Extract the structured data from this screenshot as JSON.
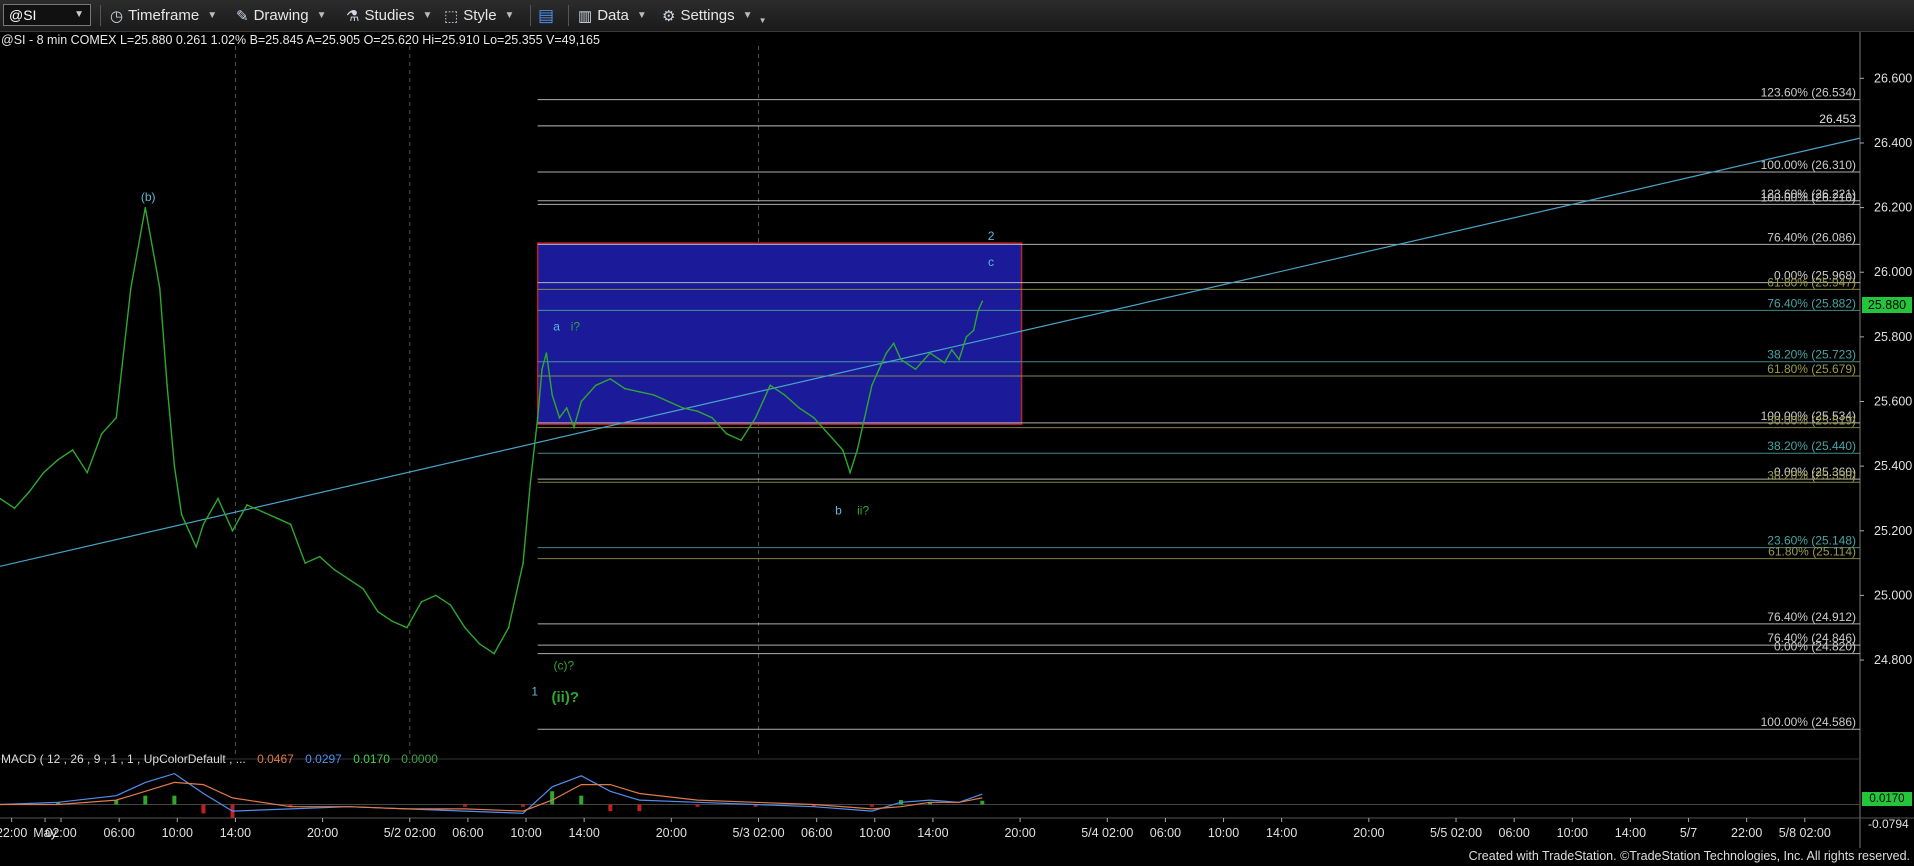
{
  "toolbar": {
    "symbol": "@SI",
    "timeframe": "Timeframe",
    "drawing": "Drawing",
    "studies": "Studies",
    "style": "Style",
    "data": "Data",
    "settings": "Settings"
  },
  "info": {
    "line": "@SI - 8 min  COMEX  L=25.880  0.261  1.02%  B=25.845  A=25.905  O=25.620  Hi=25.910  Lo=25.355  V=49,165"
  },
  "macd": {
    "label": "MACD ( 12 , 26 , 9 , 1 , 1 , UpColorDefault , ...",
    "values": [
      {
        "text": "0.0467",
        "color": "#e07a4a"
      },
      {
        "text": "0.0297",
        "color": "#4f8ff0"
      },
      {
        "text": "0.0170",
        "color": "#3ad04a"
      },
      {
        "text": "0.0000",
        "color": "#3aa04a"
      }
    ],
    "current_tag": "0.0170",
    "min_label": "-0.0794"
  },
  "last_price_tag": "25.880",
  "footer": "Created with TradeStation. ©TradeStation Technologies, Inc. All rights reserved.",
  "colors": {
    "background": "#000000",
    "price": "#2ea82e",
    "box_fill": "#1b1b9a",
    "box_border": "#c02020",
    "trendline": "#4aa3c8",
    "macd_line": "#4f8ff0",
    "signal_line": "#e07a4a",
    "hist_up": "#2ea82e",
    "hist_down": "#c02020"
  },
  "chart_data": {
    "type": "line",
    "title": "@SI - 8 min COMEX",
    "xlabel": "",
    "ylabel": "",
    "ylim": [
      24.5,
      26.7
    ],
    "y_ticks": [
      24.8,
      25.0,
      25.2,
      25.4,
      25.6,
      25.8,
      26.0,
      26.2,
      26.4,
      26.6
    ],
    "y_tick_labels": [
      "24.800",
      "25.000",
      "25.200",
      "25.400",
      "25.600",
      "25.800",
      "26.000",
      "26.200",
      "26.400",
      "26.600"
    ],
    "x_ticks": [
      {
        "label": "22:00",
        "x": 0.8
      },
      {
        "label": "May",
        "x": 3.1
      },
      {
        "label": "02:00",
        "x": 4.2
      },
      {
        "label": "06:00",
        "x": 8.2
      },
      {
        "label": "10:00",
        "x": 12.2
      },
      {
        "label": "14:00",
        "x": 16.2
      },
      {
        "label": "20:00",
        "x": 22.2
      },
      {
        "label": "5/2 02:00",
        "x": 28.2
      },
      {
        "label": "06:00",
        "x": 32.2
      },
      {
        "label": "10:00",
        "x": 36.2
      },
      {
        "label": "14:00",
        "x": 40.2
      },
      {
        "label": "20:00",
        "x": 46.2
      },
      {
        "label": "5/3 02:00",
        "x": 52.2
      },
      {
        "label": "06:00",
        "x": 56.2
      },
      {
        "label": "10:00",
        "x": 60.2
      },
      {
        "label": "14:00",
        "x": 64.2
      },
      {
        "label": "20:00",
        "x": 70.2
      },
      {
        "label": "5/4 02:00",
        "x": 76.2
      },
      {
        "label": "06:00",
        "x": 80.2
      },
      {
        "label": "10:00",
        "x": 84.2
      },
      {
        "label": "14:00",
        "x": 88.2
      },
      {
        "label": "20:00",
        "x": 94.2
      },
      {
        "label": "5/5 02:00",
        "x": 100.2
      },
      {
        "label": "06:00",
        "x": 104.2
      },
      {
        "label": "10:00",
        "x": 108.2
      },
      {
        "label": "14:00",
        "x": 112.2
      },
      {
        "label": "5/7",
        "x": 116.2
      },
      {
        "label": "22:00",
        "x": 120.2
      },
      {
        "label": "5/8 02:00",
        "x": 124.2
      }
    ],
    "x_range": [
      0,
      128
    ],
    "series": [
      {
        "x": [
          0.0,
          1.0,
          2.0,
          3.0,
          4.0,
          5.0,
          6.0,
          7.0,
          8.0,
          9.0,
          10.0,
          11.0,
          11.5,
          12.0,
          12.5,
          13.0,
          13.5,
          14.0,
          15.0,
          16.0,
          17.0,
          18.0,
          19.0,
          20.0,
          21.0,
          22.0,
          23.0,
          24.0,
          25.0,
          26.0,
          27.0,
          28.0,
          29.0,
          30.0,
          31.0,
          32.0,
          33.0,
          34.0,
          35.0,
          36.0,
          36.5,
          37.0,
          37.3,
          37.6,
          38.0,
          38.5,
          39.0,
          39.5,
          40.0,
          41.0,
          42.0,
          43.0,
          44.0,
          45.0,
          46.0,
          47.0,
          48.0,
          49.0,
          50.0,
          51.0,
          52.0,
          53.0,
          54.0,
          55.0,
          56.0,
          57.0,
          58.0,
          58.5,
          59.0,
          59.5,
          60.0,
          60.5,
          61.0,
          61.5,
          62.0,
          63.0,
          64.0,
          65.0,
          65.5,
          66.0,
          66.5,
          67.0,
          67.3,
          67.6
        ],
        "values": [
          25.3,
          25.27,
          25.32,
          25.38,
          25.42,
          25.45,
          25.38,
          25.5,
          25.55,
          25.95,
          26.2,
          25.95,
          25.65,
          25.4,
          25.25,
          25.2,
          25.15,
          25.22,
          25.3,
          25.2,
          25.28,
          25.26,
          25.24,
          25.22,
          25.1,
          25.12,
          25.08,
          25.05,
          25.02,
          24.95,
          24.92,
          24.9,
          24.98,
          25.0,
          24.97,
          24.9,
          24.85,
          24.82,
          24.9,
          25.1,
          25.35,
          25.55,
          25.7,
          25.75,
          25.62,
          25.55,
          25.58,
          25.52,
          25.6,
          25.65,
          25.67,
          25.64,
          25.63,
          25.62,
          25.6,
          25.58,
          25.57,
          25.55,
          25.5,
          25.48,
          25.55,
          25.65,
          25.62,
          25.58,
          25.55,
          25.5,
          25.45,
          25.38,
          25.45,
          25.55,
          25.65,
          25.7,
          25.75,
          25.78,
          25.73,
          25.7,
          25.75,
          25.72,
          25.76,
          25.73,
          25.8,
          25.82,
          25.88,
          25.91
        ]
      }
    ],
    "fib_levels": [
      {
        "label": "123.60% (26.534)",
        "value": 26.534,
        "color": "#cccccc"
      },
      {
        "label": "26.453",
        "value": 26.453,
        "color": "#e0e0e0"
      },
      {
        "label": "100.00% (26.310)",
        "value": 26.31,
        "color": "#cccccc"
      },
      {
        "label": "123.60% (26.221)",
        "value": 26.221,
        "color": "#cccccc"
      },
      {
        "label": "100.00% (26.210)",
        "value": 26.21,
        "color": "#cccccc"
      },
      {
        "label": "76.40% (26.086)",
        "value": 26.086,
        "color": "#cccccc"
      },
      {
        "label": "0.00% (25.968)",
        "value": 25.968,
        "color": "#cccccc"
      },
      {
        "label": "61.80% (25.947)",
        "value": 25.947,
        "color": "#9b9b4a"
      },
      {
        "label": "76.40% (25.882)",
        "value": 25.882,
        "color": "#4aa3a3"
      },
      {
        "label": "38.20% (25.723)",
        "value": 25.723,
        "color": "#4aa3a3"
      },
      {
        "label": "61.80% (25.679)",
        "value": 25.679,
        "color": "#9b9b4a"
      },
      {
        "label": "100.00% (25.534)",
        "value": 25.534,
        "color": "#cccccc"
      },
      {
        "label": "50.00% (25.519)",
        "value": 25.519,
        "color": "#9b9b4a"
      },
      {
        "label": "38.20% (25.440)",
        "value": 25.44,
        "color": "#4aa3a3"
      },
      {
        "label": "0.00% (25.360)",
        "value": 25.36,
        "color": "#cccccc"
      },
      {
        "label": "38.20% (25.350)",
        "value": 25.35,
        "color": "#9b9b4a"
      },
      {
        "label": "23.60% (25.148)",
        "value": 25.148,
        "color": "#4aa3a3"
      },
      {
        "label": "61.80% (25.114)",
        "value": 25.114,
        "color": "#9b9b4a"
      },
      {
        "label": "76.40% (24.912)",
        "value": 24.912,
        "color": "#cccccc"
      },
      {
        "label": "76.40% (24.846)",
        "value": 24.846,
        "color": "#cccccc"
      },
      {
        "label": "0.00% (24.820)",
        "value": 24.82,
        "color": "#cccccc"
      },
      {
        "label": "100.00% (24.586)",
        "value": 24.586,
        "color": "#cccccc"
      }
    ],
    "box": {
      "x_start": 37.0,
      "x_end": 70.3,
      "y_low": 25.53,
      "y_high": 26.09
    },
    "trendline": {
      "x1": 0,
      "y1": 25.09,
      "x2": 128,
      "y2": 26.415
    },
    "wave_labels": [
      {
        "text": "(b)",
        "x": 10.2,
        "value": 26.22,
        "color": "#5fb8d8"
      },
      {
        "text": "a",
        "x": 38.3,
        "value": 25.82,
        "color": "#5fb8d8"
      },
      {
        "text": "i?",
        "x": 39.6,
        "value": 25.82,
        "color": "#2ea82e"
      },
      {
        "text": "b",
        "x": 57.7,
        "value": 25.25,
        "color": "#5fb8d8"
      },
      {
        "text": "ii?",
        "x": 59.4,
        "value": 25.25,
        "color": "#2ea82e"
      },
      {
        "text": "2",
        "x": 68.2,
        "value": 26.1,
        "color": "#5fb8d8"
      },
      {
        "text": "c",
        "x": 68.2,
        "value": 26.02,
        "color": "#5fb8d8"
      },
      {
        "text": "1",
        "x": 36.8,
        "value": 24.69,
        "color": "#5fb8d8"
      },
      {
        "text": "(c)?",
        "x": 38.8,
        "value": 24.77,
        "color": "#2ea82e"
      },
      {
        "text": "(ii)?",
        "x": 38.9,
        "value": 24.67,
        "color": "#2ea82e"
      }
    ],
    "macd": {
      "x": [
        0,
        4,
        8,
        10,
        12,
        14,
        16,
        20,
        24,
        28,
        32,
        36,
        38,
        40,
        42,
        44,
        48,
        52,
        56,
        60,
        62,
        64,
        66,
        67.6
      ],
      "macd_line": [
        0.0,
        0.01,
        0.04,
        0.1,
        0.14,
        0.05,
        -0.03,
        -0.02,
        -0.01,
        -0.02,
        -0.03,
        -0.04,
        0.08,
        0.13,
        0.06,
        0.02,
        0.01,
        0.0,
        -0.01,
        -0.03,
        0.01,
        0.02,
        0.01,
        0.047
      ],
      "signal_line": [
        0.0,
        0.0,
        0.02,
        0.06,
        0.1,
        0.09,
        0.03,
        -0.01,
        -0.01,
        -0.02,
        -0.02,
        -0.03,
        0.02,
        0.09,
        0.09,
        0.05,
        0.02,
        0.01,
        0.0,
        -0.02,
        -0.01,
        0.01,
        0.01,
        0.03
      ],
      "ylim": [
        -0.0794,
        0.17
      ]
    }
  }
}
